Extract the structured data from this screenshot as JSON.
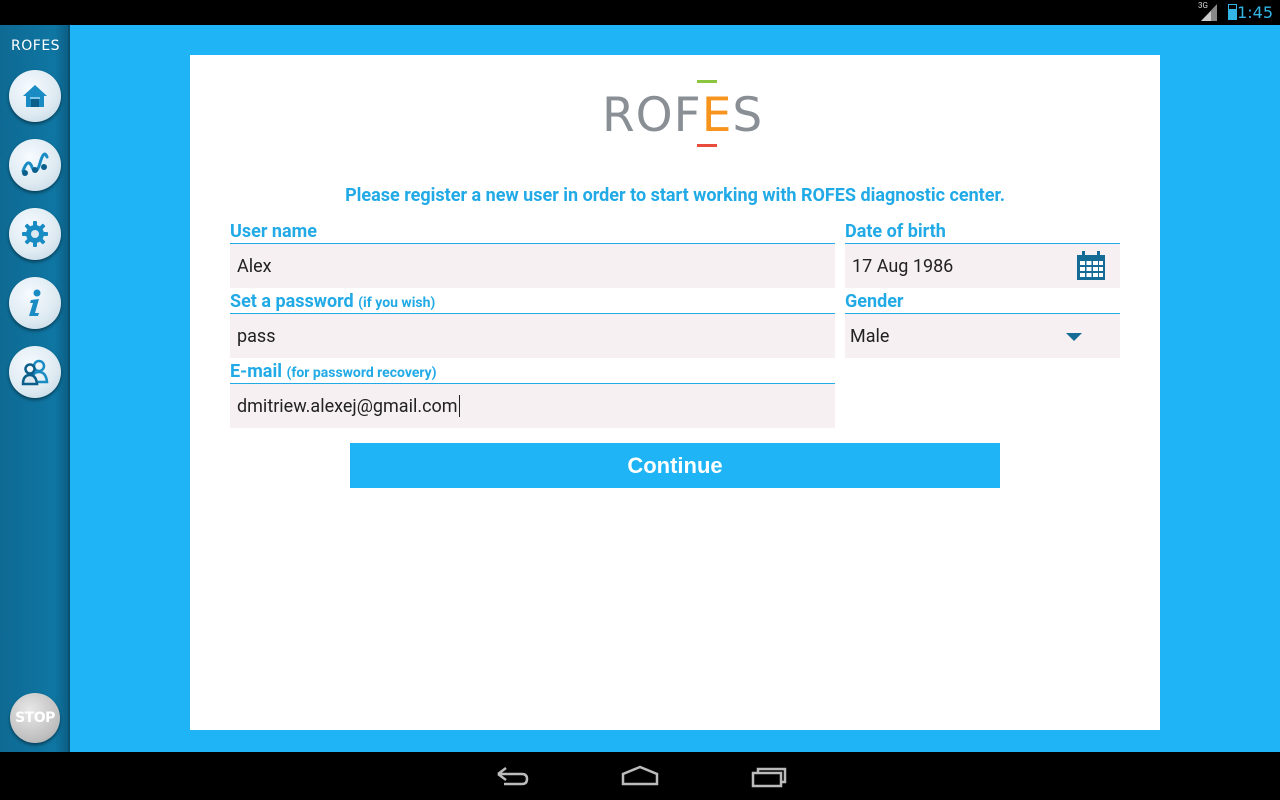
{
  "status_bar": {
    "network": "3G",
    "time": "1:45"
  },
  "sidebar": {
    "logo": {
      "prefix": "ROF",
      "e": "E",
      "suffix": "S"
    },
    "items": [
      {
        "icon": "home-icon"
      },
      {
        "icon": "chart-icon"
      },
      {
        "icon": "gear-icon"
      },
      {
        "icon": "info-icon"
      },
      {
        "icon": "users-icon"
      }
    ],
    "stop_label": "STOP"
  },
  "logo": {
    "prefix": "ROF",
    "e": "E",
    "suffix": "S"
  },
  "form": {
    "intro": "Please register a new user in order to start working with ROFES diagnostic center.",
    "username": {
      "label": "User name",
      "value": "Alex"
    },
    "password": {
      "label": "Set a password",
      "hint": "(if you wish)",
      "value": "pass"
    },
    "email": {
      "label": "E-mail",
      "hint": "(for password recovery)",
      "value": "dmitriew.alexej@gmail.com"
    },
    "dob": {
      "label": "Date of birth",
      "value": "17 Aug 1986"
    },
    "gender": {
      "label": "Gender",
      "value": "Male"
    },
    "continue_label": "Continue"
  },
  "colors": {
    "accent": "#1eb4f5",
    "label": "#21aae6",
    "sidebar": "#0f76a3",
    "logo_e": "#f7941d",
    "logo_top": "#8cc63f",
    "logo_bottom": "#e84c3d"
  }
}
